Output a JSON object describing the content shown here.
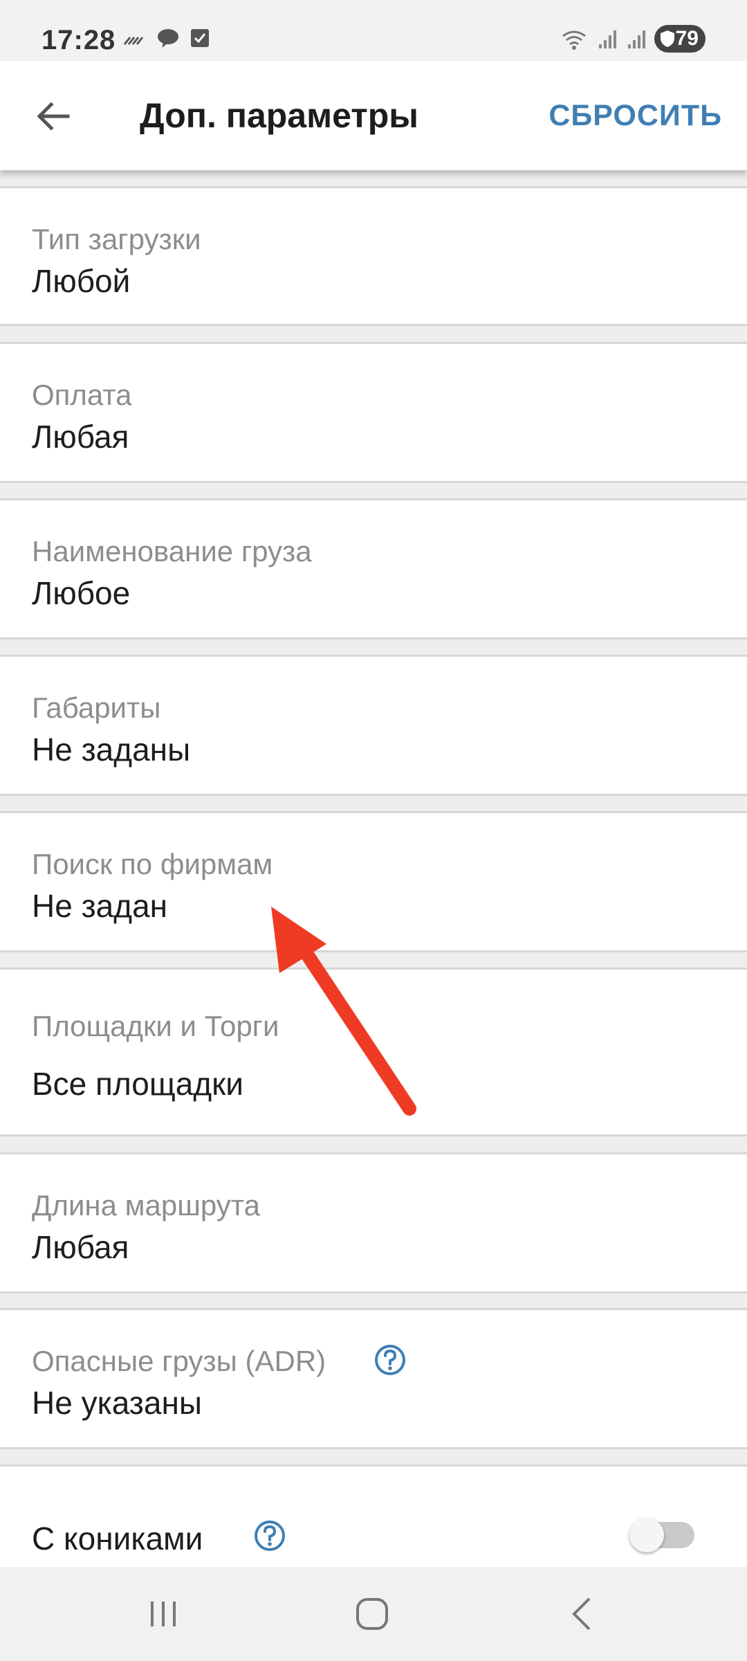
{
  "status_bar": {
    "time": "17:28",
    "battery": "79",
    "icons": [
      "signal-slash-icon",
      "chat-icon",
      "checkbox-icon",
      "wifi-icon",
      "signal-icon",
      "signal-icon",
      "shield-icon"
    ]
  },
  "app_bar": {
    "title": "Доп. параметры",
    "reset_label": "СБРОСИТЬ",
    "back_icon": "back-arrow-icon"
  },
  "settings": [
    {
      "label": "Тип загрузки",
      "value": "Любой"
    },
    {
      "label": "Оплата",
      "value": "Любая"
    },
    {
      "label": "Наименование груза",
      "value": "Любое"
    },
    {
      "label": "Габариты",
      "value": "Не заданы"
    },
    {
      "label": "Поиск по фирмам",
      "value": "Не задан"
    },
    {
      "label": "Площадки и Торги",
      "value": "Все площадки"
    },
    {
      "label": "Длина маршрута",
      "value": "Любая"
    },
    {
      "label": "Опасные грузы (ADR)",
      "value": "Не указаны",
      "help": true
    }
  ],
  "toggle_row": {
    "label": "С кониками",
    "help": true,
    "enabled": false
  },
  "nav_bar": {
    "icons": [
      "recent-apps-icon",
      "home-icon",
      "back-icon"
    ]
  },
  "colors": {
    "accent": "#3f7fb4",
    "annotation_arrow": "#ef3b24"
  }
}
